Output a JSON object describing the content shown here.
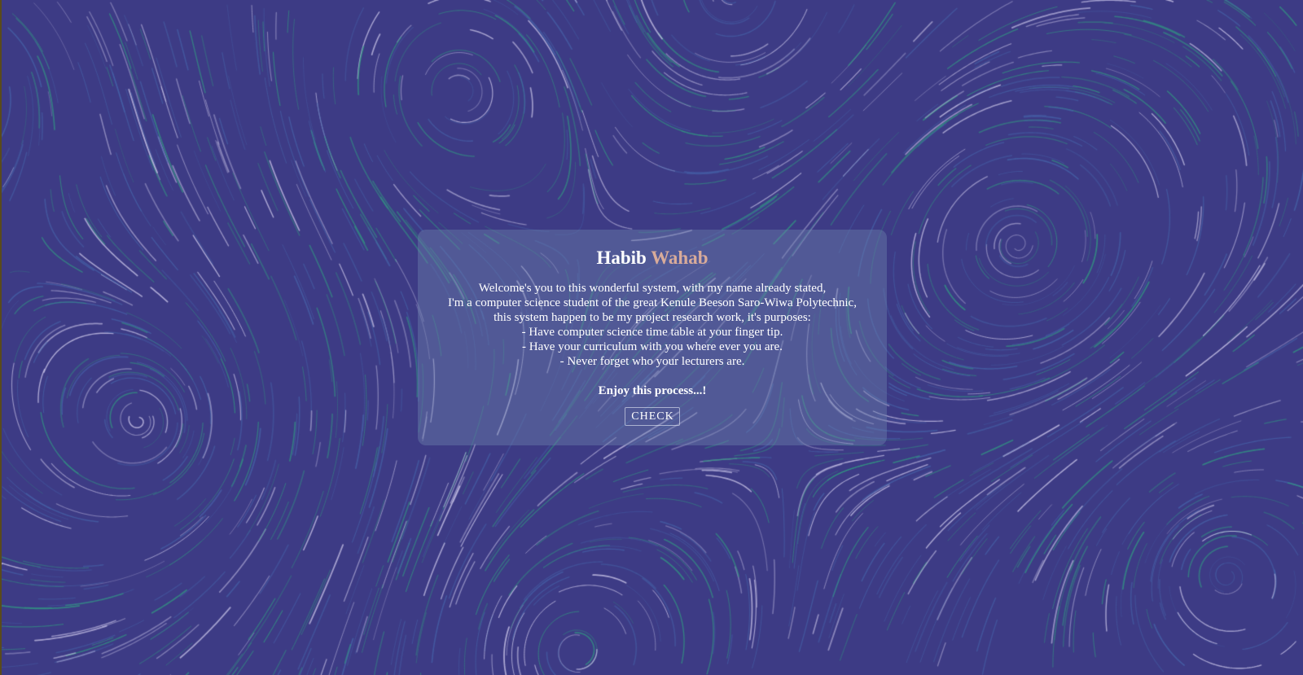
{
  "colors": {
    "background": "#3d3b85",
    "card": "rgba(110,130,175,0.42)",
    "accent": "#d8ab9a",
    "streak_light": "#c9c6e6",
    "streak_green": "#2f8f86"
  },
  "card": {
    "title_first": "Habib",
    "title_last": "Wahab",
    "description_lines": [
      "Welcome's you to this wonderful system, with my name already stated,",
      "I'm a computer science student of the great Kenule Beeson Saro-Wiwa Polytechnic,",
      "this system happen to be my project research work, it's purposes:",
      "- Have computer science time table at your finger tip.",
      "- Have your curriculum with you where ever you are.",
      "- Never forget who your lecturers are."
    ],
    "enjoy_text": "Enjoy this process...!",
    "check_label": "CHECK"
  }
}
